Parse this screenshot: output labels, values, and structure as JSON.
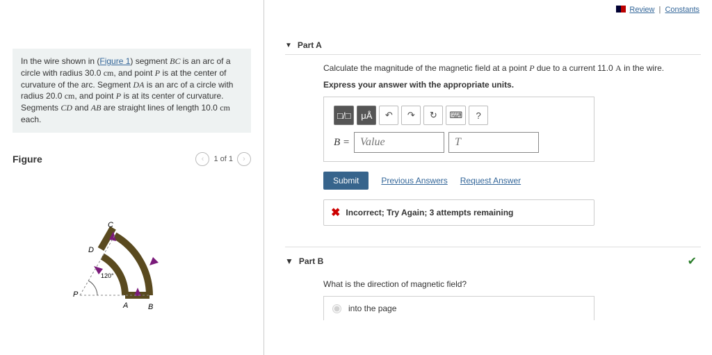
{
  "toplinks": {
    "review": "Review",
    "constants": "Constants"
  },
  "prompt": {
    "t0": "In the wire shown in (",
    "fig_link": "Figure 1",
    "t1": ") segment ",
    "seg1": "BC",
    "t2": " is an arc of a circle with radius 30.0 ",
    "unit_cm": "cm",
    "t3": ", and point ",
    "pt": "P",
    "t4": " is at the center of curvature of the arc. Segment ",
    "seg2": "DA",
    "t5": " is an arc of a circle with radius 20.0 ",
    "t6": ", and point ",
    "t7": " is at its center of curvature. Segments ",
    "seg3": "CD",
    "and": " and ",
    "seg4": "AB",
    "t8": " are straight lines of length 10.0 ",
    "t9": " each."
  },
  "figure": {
    "title": "Figure",
    "pager": "1 of 1",
    "angle": "120°",
    "A": "A",
    "B": "B",
    "C": "C",
    "D": "D",
    "P": "P"
  },
  "partA": {
    "label": "Part A",
    "q0": "Calculate the magnitude of the magnetic field at a point ",
    "P": "P",
    "q1": " due to a current 11.0 ",
    "unit_A": "A",
    "q2": " in the wire.",
    "instr": "Express your answer with the appropriate units.",
    "toolbar": {
      "tmpl": "□/□",
      "ua": "μÅ",
      "undo": "↶",
      "redo": "↷",
      "reset": "↻",
      "kbd": "⌨",
      "help": "?"
    },
    "Blabel": "B =",
    "val_ph": "Value",
    "unit_ph": "T",
    "submit": "Submit",
    "prev": "Previous Answers",
    "req": "Request Answer",
    "feedback": "Incorrect; Try Again; 3 attempts remaining"
  },
  "partB": {
    "label": "Part B",
    "q": "What is the direction of magnetic field?",
    "opt1": "into the page"
  }
}
